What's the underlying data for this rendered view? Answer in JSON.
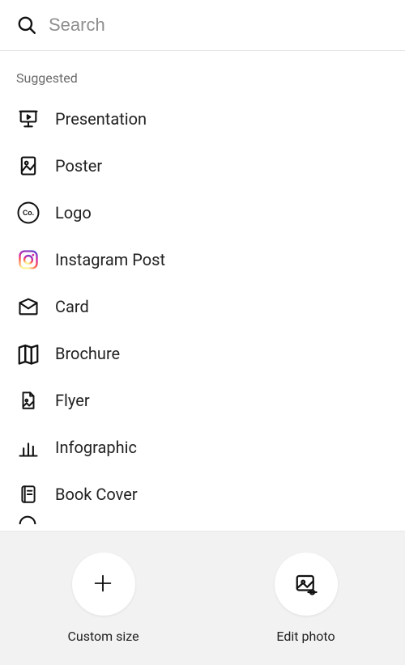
{
  "search": {
    "placeholder": "Search",
    "value": ""
  },
  "section_label": "Suggested",
  "suggested": [
    {
      "key": "presentation",
      "label": "Presentation",
      "icon": "presentation-icon"
    },
    {
      "key": "poster",
      "label": "Poster",
      "icon": "poster-icon"
    },
    {
      "key": "logo",
      "label": "Logo",
      "icon": "logo-icon"
    },
    {
      "key": "instagram",
      "label": "Instagram Post",
      "icon": "instagram-icon"
    },
    {
      "key": "card",
      "label": "Card",
      "icon": "card-icon"
    },
    {
      "key": "brochure",
      "label": "Brochure",
      "icon": "brochure-icon"
    },
    {
      "key": "flyer",
      "label": "Flyer",
      "icon": "flyer-icon"
    },
    {
      "key": "infographic",
      "label": "Infographic",
      "icon": "infographic-icon"
    },
    {
      "key": "bookcover",
      "label": "Book Cover",
      "icon": "book-cover-icon"
    }
  ],
  "bottom": {
    "custom_size": {
      "label": "Custom size",
      "icon": "plus-icon"
    },
    "edit_photo": {
      "label": "Edit photo",
      "icon": "edit-photo-icon"
    }
  }
}
